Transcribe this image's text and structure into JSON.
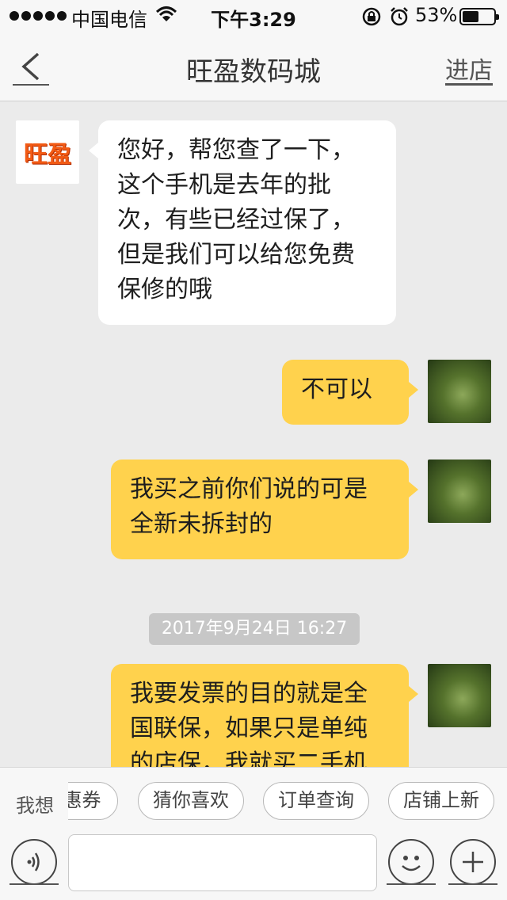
{
  "status_bar": {
    "carrier": "中国电信",
    "time": "下午3:29",
    "battery_percent": "53%",
    "battery_level": 0.53
  },
  "nav": {
    "title": "旺盈数码城",
    "enter_store": "进店"
  },
  "shop": {
    "avatar_text": "旺盈"
  },
  "messages": [
    {
      "side": "left",
      "text": "您好，帮您查了一下，这个手机是去年的批次，有些已经过保了，但是我们可以给您免费保修的哦"
    },
    {
      "side": "right",
      "text": "不可以"
    },
    {
      "side": "right",
      "text": "我买之前你们说的可是全新未拆封的"
    },
    {
      "side": "right",
      "text": "我要发票的目的就是全国联保，如果只是单纯的店保，我就买二手机"
    }
  ],
  "timestamp": "2017年9月24日 16:27",
  "quick_replies": {
    "label": "我想",
    "items": [
      "优惠券",
      "猜你喜欢",
      "订单查询",
      "店铺上新"
    ]
  },
  "icons": {
    "back": "back-icon",
    "voice": "voice-icon",
    "emoji": "emoji-icon",
    "plus": "plus-icon",
    "wifi": "wifi-icon",
    "lock": "orientation-lock-icon",
    "alarm": "alarm-icon"
  }
}
